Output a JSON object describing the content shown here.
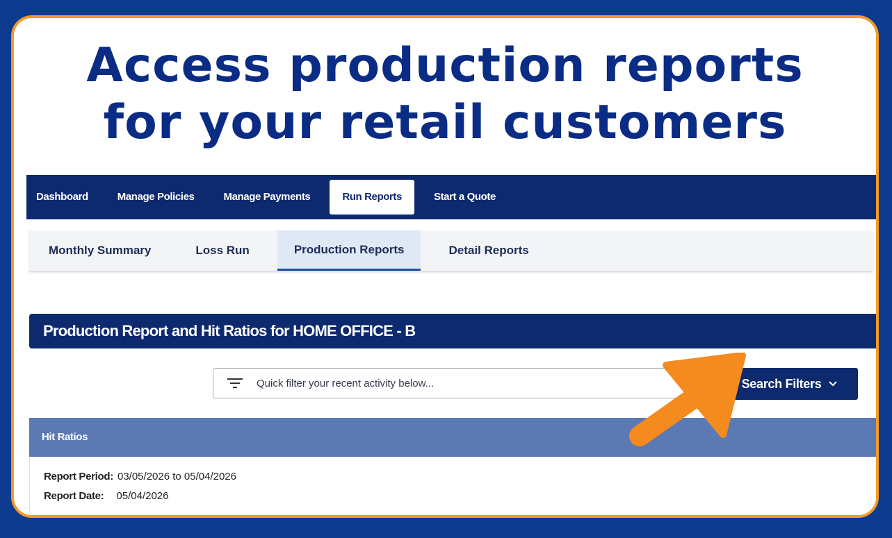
{
  "headline": {
    "line1": "Access production reports",
    "line2": "for your retail customers"
  },
  "topnav": {
    "items": [
      {
        "label": "Dashboard"
      },
      {
        "label": "Manage Policies"
      },
      {
        "label": "Manage Payments"
      },
      {
        "label": "Run Reports",
        "active": true
      },
      {
        "label": "Start a Quote"
      }
    ]
  },
  "subnav": {
    "items": [
      {
        "label": "Monthly Summary"
      },
      {
        "label": "Loss Run"
      },
      {
        "label": "Production Reports",
        "active": true
      },
      {
        "label": "Detail Reports"
      }
    ]
  },
  "report": {
    "title": "Production Report and Hit Ratios for HOME OFFICE - B"
  },
  "filter": {
    "placeholder": "Quick filter your recent activity below...",
    "icon": "filter-icon"
  },
  "search_filters": {
    "label": "Search Filters",
    "icon": "chevron-down-icon"
  },
  "hit_ratios": {
    "title": "Hit Ratios",
    "report_period_label": "Report Period:",
    "report_period_value": "03/05/2026 to 05/04/2026",
    "report_date_label": "Report Date:",
    "report_date_value": "05/04/2026"
  },
  "colors": {
    "background": "#0b3a8f",
    "card_border": "#f39a2a",
    "headline": "#0b2c85",
    "nav_bg": "#0e2a6e",
    "section_bar": "#5b79b3",
    "arrow": "#f58a1f"
  }
}
